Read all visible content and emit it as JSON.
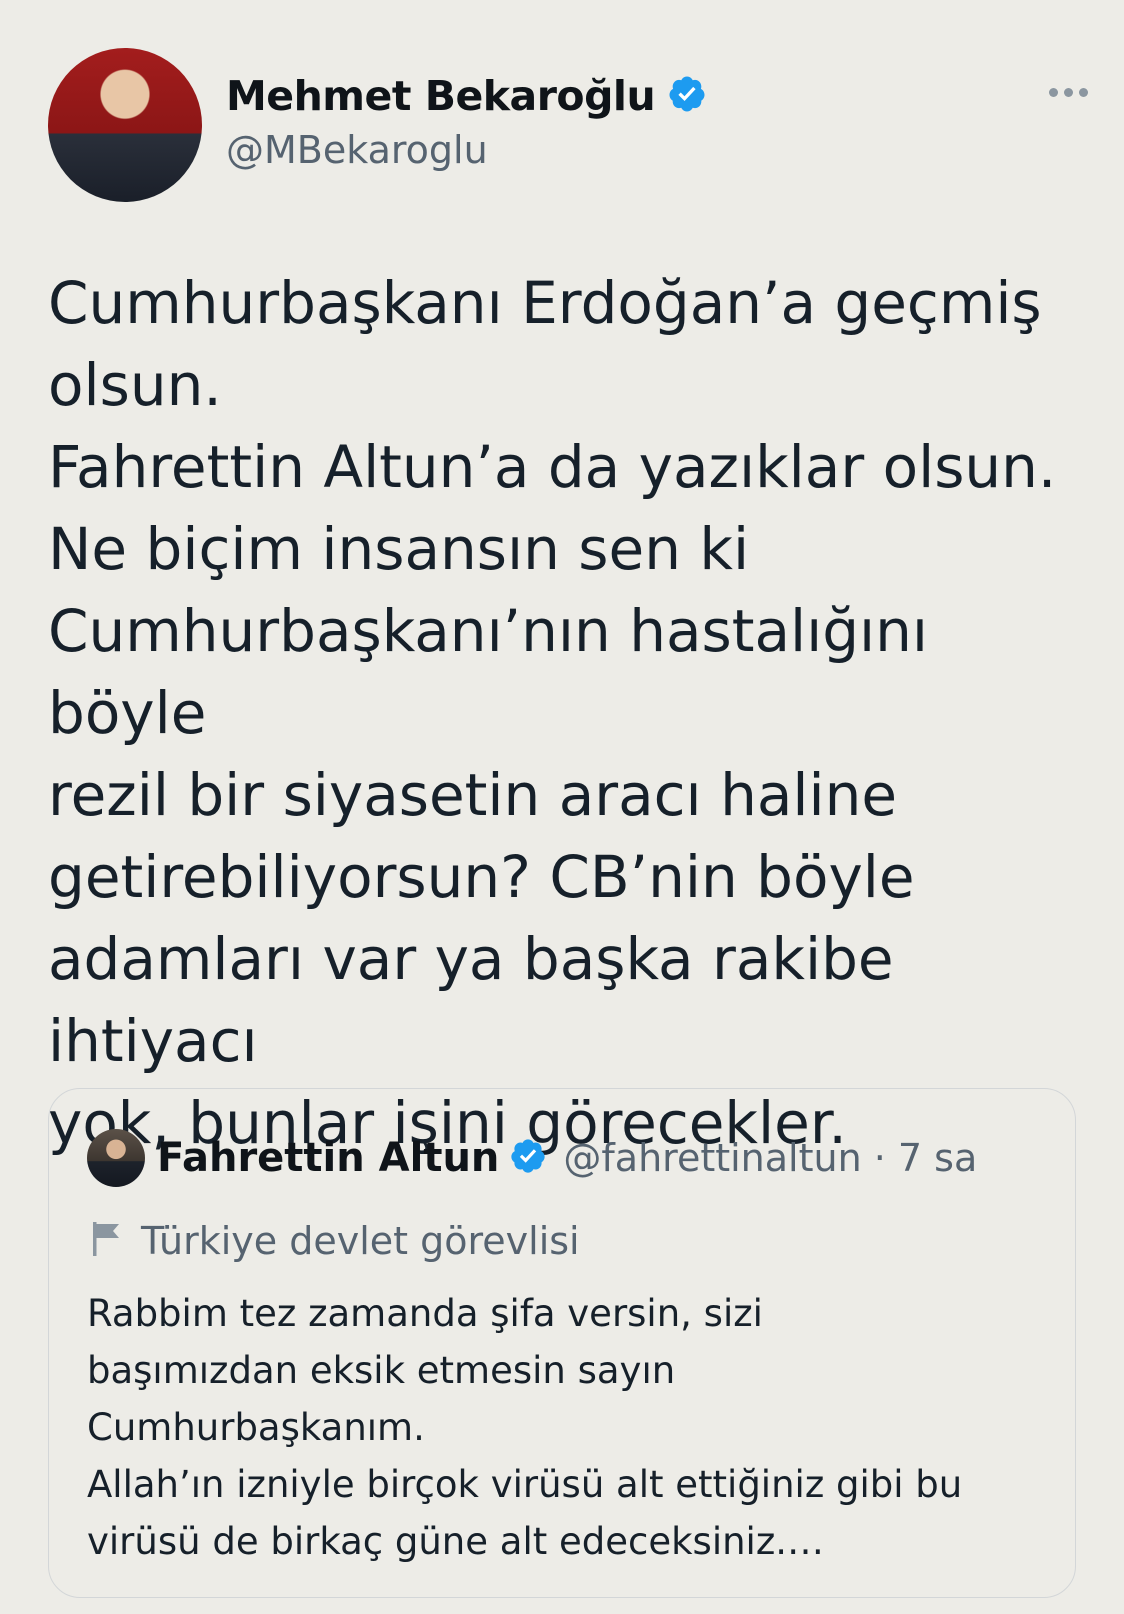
{
  "author": {
    "display_name": "Mehmet Bekaroğlu",
    "handle": "@MBekaroglu",
    "verified_icon": "verified-badge-icon"
  },
  "tweet": {
    "text": "Cumhurbaşkanı Erdoğan’a geçmiş\nolsun.\nFahrettin Altun’a da yazıklar olsun.\nNe biçim insansın sen ki\nCumhurbaşkanı’nın hastalığını böyle\nrezil bir siyasetin aracı haline\ngetirebiliyorsun? CB’nin böyle\nadamları var ya başka rakibe ihtiyacı\nyok, bunlar işini görecekler."
  },
  "quoted": {
    "display_name": "Fahrettin Altun",
    "handle_time": "@fahrettinaltun · 7 sa",
    "label": "Türkiye devlet görevlisi",
    "label_icon": "flag-icon",
    "text": "Rabbim tez zamanda şifa versin, sizi\nbaşımızdan eksik etmesin sayın\nCumhurbaşkanım.\nAllah’ın izniyle birçok virüsü alt ettiğiniz gibi bu\nvirüsü de birkaç güne alt edeceksiniz.…"
  },
  "colors": {
    "background": "#edece7",
    "text": "#16202a",
    "secondary_text": "#566370",
    "verified": "#1d9bf0",
    "border": "#d3d6d8"
  }
}
